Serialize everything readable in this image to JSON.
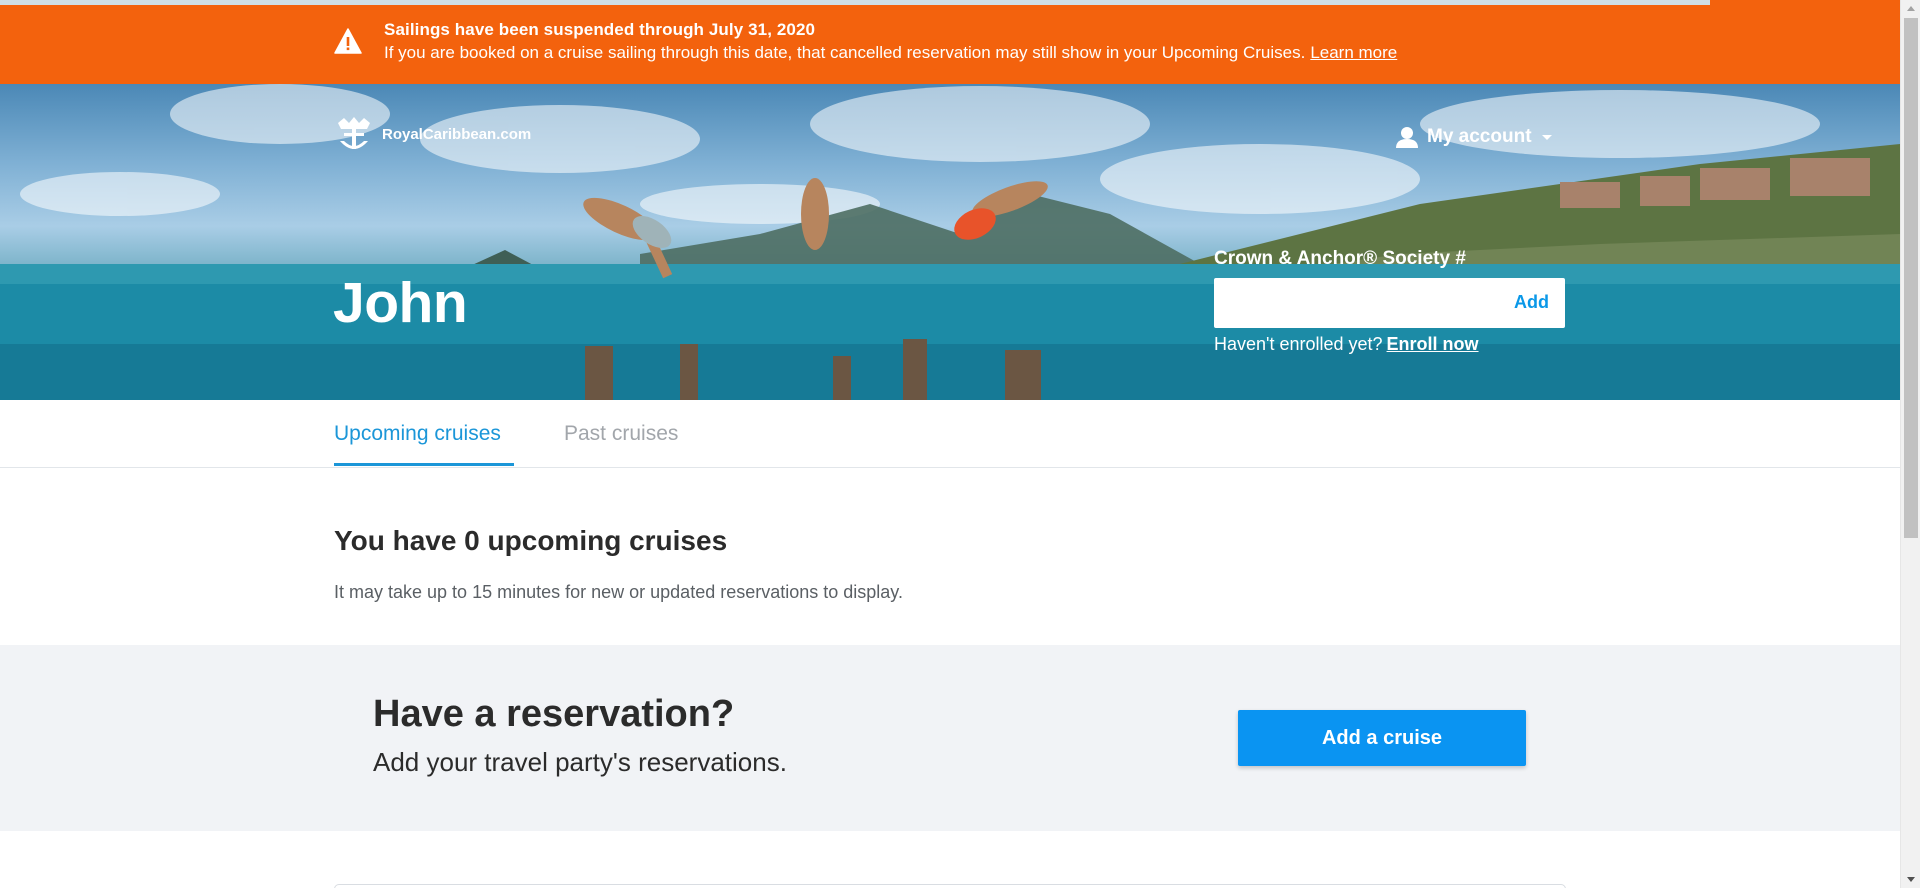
{
  "alert": {
    "title": "Sailings have been suspended through July 31, 2020",
    "message": "If you are booked on a cruise sailing through this date, that cancelled reservation may still show in your Upcoming Cruises.",
    "link_label": "Learn more",
    "color": "#f3620d"
  },
  "header": {
    "brand": "RoyalCaribbean.com",
    "account_label": "My account",
    "logo_icon": "royal-caribbean-crown-anchor-logo",
    "user_icon": "user-icon"
  },
  "hero": {
    "name": "John",
    "society_label": "Crown & Anchor® Society #",
    "society_value": "",
    "society_add": "Add",
    "enroll_prompt": "Haven't enrolled yet?",
    "enroll_link": "Enroll now"
  },
  "tabs": [
    {
      "label": "Upcoming cruises",
      "active": true
    },
    {
      "label": "Past cruises",
      "active": false
    }
  ],
  "upcoming": {
    "title": "You have 0 upcoming cruises",
    "note": "It may take up to 15 minutes for new or updated reservations to display."
  },
  "reservation": {
    "title": "Have a reservation?",
    "subtitle": "Add your travel party's reservations.",
    "button_label": "Add a cruise",
    "button_color": "#0a94f2"
  },
  "colors": {
    "accent_blue": "#1b96d8",
    "band_gray": "#f1f3f6"
  }
}
